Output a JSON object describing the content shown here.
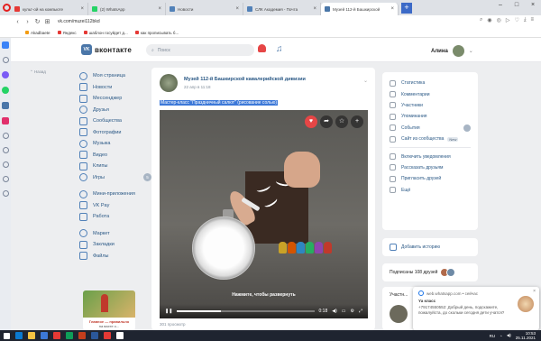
{
  "browser": {
    "tabs": [
      {
        "title": "культ-ой на компьюте",
        "color": "#e53935",
        "active": false
      },
      {
        "title": "(2) WhatsApp",
        "color": "#25d366",
        "active": false
      },
      {
        "title": "Новости",
        "color": "#5181b8",
        "active": false
      },
      {
        "title": "СЛК Академия - Почта",
        "color": "#5181b8",
        "active": false
      },
      {
        "title": "Музей 112-й Башкирской",
        "color": "#4a76a8",
        "active": true
      }
    ],
    "new_tab": "+",
    "url": "vk.com/muzei112bkd",
    "bookmarks": [
      {
        "label": "Akadbaete",
        "color": "#f39c12"
      },
      {
        "label": "Яндекс",
        "color": "#e53935"
      },
      {
        "label": "шаблон госуйдет д...",
        "color": "#e53935"
      },
      {
        "label": "как прописывать б...",
        "color": "#e53935"
      }
    ]
  },
  "vk": {
    "logo_text": "вконтакте",
    "logo_mark": "VK",
    "search_placeholder": "Поиск",
    "user_name": "Алина",
    "back_link": "Назад",
    "menu": [
      {
        "label": "Моя страница"
      },
      {
        "label": "Новости"
      },
      {
        "label": "Мессенджер"
      },
      {
        "label": "Друзья"
      },
      {
        "label": "Сообщества"
      },
      {
        "label": "Фотографии"
      },
      {
        "label": "Музыка"
      },
      {
        "label": "Видео"
      },
      {
        "label": "Клипы"
      },
      {
        "label": "Игры",
        "badge": "5"
      }
    ],
    "menu2": [
      {
        "label": "Мини-приложения"
      },
      {
        "label": "VK Pay"
      },
      {
        "label": "Работа"
      }
    ],
    "menu3": [
      {
        "label": "Маркет"
      },
      {
        "label": "Закладки"
      },
      {
        "label": "Файлы"
      }
    ],
    "ad": {
      "caption": "Главное — правильно",
      "caption2": "на вахте о..."
    }
  },
  "post": {
    "author": "Музей 112-й Башкирской кавалерийской дивизии",
    "date": "22 апр в 11:18",
    "text": "Мастер-класс \"Праздничный салют\" (рисование солью)",
    "video_hint": "Нажмите, чтобы развернуть",
    "video_time": "0:18",
    "video_progress": 0.32,
    "views": "301 просмотр"
  },
  "right_nav": {
    "items": [
      {
        "label": "Статистика"
      },
      {
        "label": "Комментарии"
      },
      {
        "label": "Участники"
      },
      {
        "label": "Упоминания"
      },
      {
        "label": "События"
      },
      {
        "label": "Сайт из сообщества",
        "tag": "New"
      }
    ],
    "items2": [
      {
        "label": "Включить уведомления"
      },
      {
        "label": "Рассказать друзьям"
      },
      {
        "label": "Пригласить друзей"
      },
      {
        "label": "Ещё"
      }
    ]
  },
  "story": {
    "label": "Добавить историю"
  },
  "subscribers": {
    "label": "Подписаны 108 друзей"
  },
  "participants": {
    "label": "Участн..."
  },
  "notification": {
    "source": "web.whatsapp.com • сейчас",
    "title": "Ya класс",
    "body": "+79174550552: Добрый день, подскажите, пожалуйста, до скольки сегодня дети учатся?"
  },
  "taskbar": {
    "lang": "RU",
    "time": "10:53",
    "date": "25.11.2021",
    "icons": [
      "#0b79d0",
      "#f6c343",
      "#3c78d8",
      "#e53935",
      "#0f9d58",
      "#c43e1c",
      "#2b579a",
      "#e53935",
      "#ffffff"
    ]
  }
}
